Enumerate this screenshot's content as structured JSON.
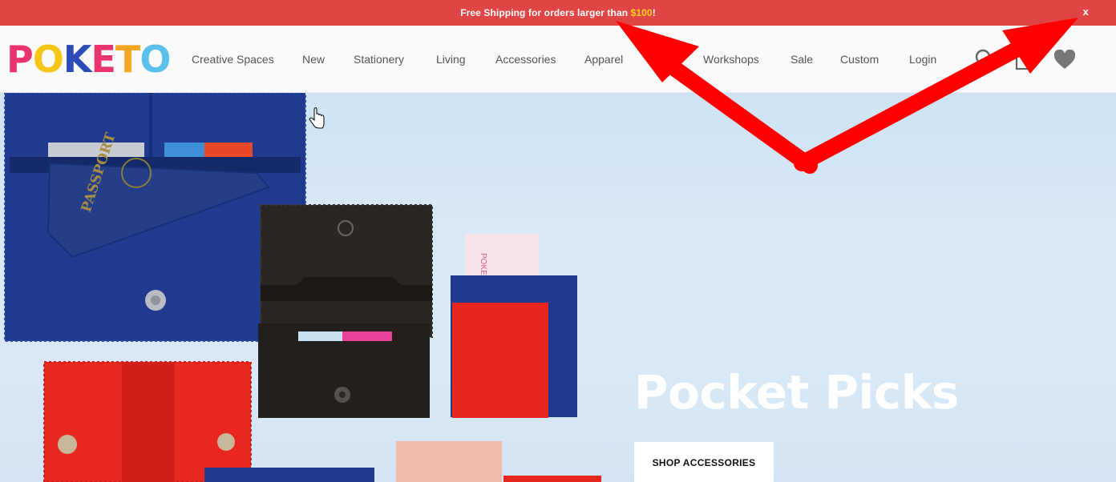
{
  "promo": {
    "text_before": "Free Shipping for orders larger than ",
    "amount": "$100",
    "text_after": "!",
    "close_label": "x",
    "background": "#e04545",
    "accent": "#ffd21f"
  },
  "logo": {
    "letters": [
      "P",
      "O",
      "K",
      "E",
      "T",
      "O"
    ],
    "colors": [
      "#e8336d",
      "#f5c518",
      "#2b4bb6",
      "#e8336d",
      "#f5c518",
      "#5bc0eb"
    ]
  },
  "nav": {
    "items": [
      "Creative Spaces",
      "New",
      "Stationery",
      "Living",
      "Accessories",
      "Apparel",
      "Workshops",
      "Sale",
      "Custom",
      "Login"
    ]
  },
  "icons": {
    "search": "search-icon",
    "bag": "shopping-bag-icon",
    "wishlist": "heart-icon"
  },
  "hero": {
    "title": "Pocket Picks",
    "cta_label": "SHOP ACCESSORIES",
    "passport_text": "PASSPORT",
    "card_text": "POKETO"
  }
}
